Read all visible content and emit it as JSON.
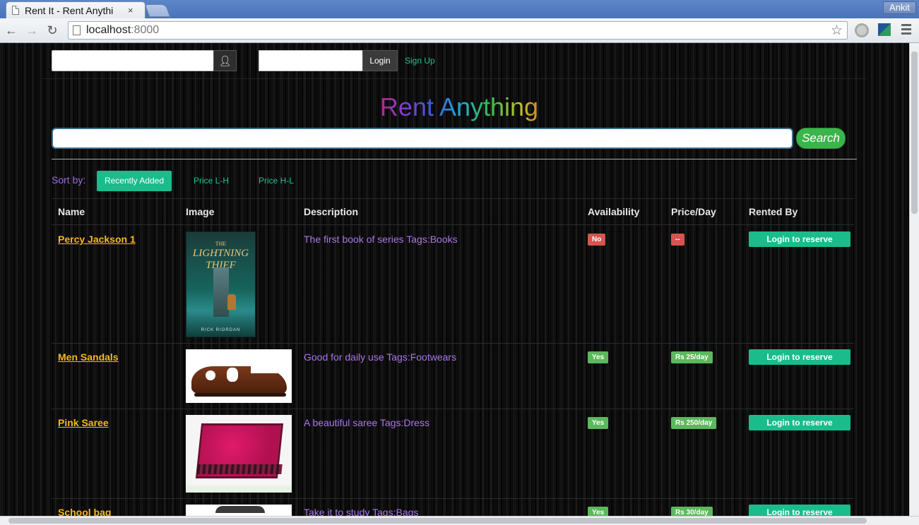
{
  "browser": {
    "tab_title": "Rent It - Rent Anythi",
    "tab_close": "×",
    "profile_name": "Ankit",
    "url_host": "localhost",
    "url_port": ":8000"
  },
  "auth": {
    "login_label": "Login",
    "signup_label": "Sign Up"
  },
  "site": {
    "title": "Rent Anything",
    "search_label": "Search"
  },
  "sort": {
    "label": "Sort by:",
    "options": [
      "Recently Added",
      "Price L-H",
      "Price H-L"
    ],
    "active": "Recently Added"
  },
  "table": {
    "headers": [
      "Name",
      "Image",
      "Description",
      "Availability",
      "Price/Day",
      "Rented By"
    ],
    "rows": [
      {
        "name": "Percy Jackson 1",
        "description": "The first book of series Tags:Books",
        "availability": "No",
        "price": "--",
        "action": "Login to reserve",
        "image": {
          "line1": "THE",
          "line2": "LIGHTNING THIEF",
          "author": "RICK RIORDAN"
        }
      },
      {
        "name": "Men Sandals",
        "description": "Good for daily use Tags:Footwears",
        "availability": "Yes",
        "price": "Rs 25/day",
        "action": "Login to reserve"
      },
      {
        "name": "Pink Saree",
        "description": "A beautiful saree Tags:Dress",
        "availability": "Yes",
        "price": "Rs 250/day",
        "action": "Login to reserve"
      },
      {
        "name": "School bag",
        "description": "Take it to study Tags:Bags",
        "availability": "Yes",
        "price": "Rs 30/day",
        "action": "Login to reserve"
      }
    ]
  },
  "icons": {
    "user_addon": "user-icon",
    "star": "bookmark-star-icon"
  },
  "colors": {
    "accent_green": "#1abc8c",
    "link_gold": "#f5b81e",
    "desc_purple": "#a877e8",
    "badge_no": "#d9534f",
    "badge_yes": "#5cb85c"
  }
}
